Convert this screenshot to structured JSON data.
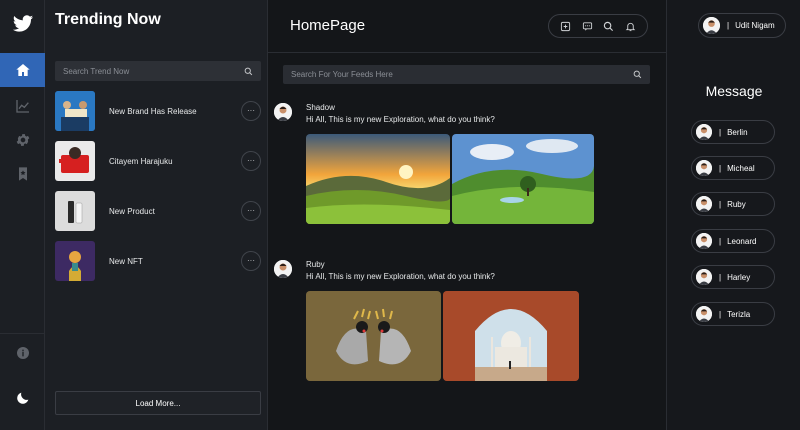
{
  "rail": {
    "logo": "twitter-bird-icon",
    "items": [
      {
        "icon": "home-icon",
        "active": true
      },
      {
        "icon": "trending-chart-icon",
        "active": false
      },
      {
        "icon": "gear-icon",
        "active": false
      },
      {
        "icon": "bookmark-icon",
        "active": false
      }
    ],
    "bottom": [
      "info-icon",
      "moon-icon"
    ]
  },
  "trending": {
    "title": "Trending Now",
    "search_placeholder": "Search Trend Now",
    "items": [
      {
        "label": "New Brand Has Release",
        "more": "···"
      },
      {
        "label": "Citayem Harajuku",
        "more": "···"
      },
      {
        "label": "New Product",
        "more": "···"
      },
      {
        "label": "New NFT",
        "more": "···"
      }
    ],
    "load_more": "Load More..."
  },
  "main": {
    "title": "HomePage",
    "tools": [
      "add-square-icon",
      "chat-icon",
      "search-icon",
      "bell-icon"
    ],
    "search_placeholder": "Search For Your Feeds Here",
    "posts": [
      {
        "name": "Shadow",
        "text": "Hi All, This is my new Exploration, what do you think?"
      },
      {
        "name": "Ruby",
        "text": "Hi All, This is my new Exploration, what do you think?"
      }
    ]
  },
  "user": {
    "separator": "|",
    "name": "Udit Nigam"
  },
  "messages": {
    "title": "Message",
    "separator": "|",
    "contacts": [
      "Berlin",
      "Micheal",
      "Ruby",
      "Leonard",
      "Harley",
      "Terizla"
    ]
  },
  "colors": {
    "accent": "#3066b6",
    "background": "#16181c",
    "panel": "#1c1f24"
  }
}
